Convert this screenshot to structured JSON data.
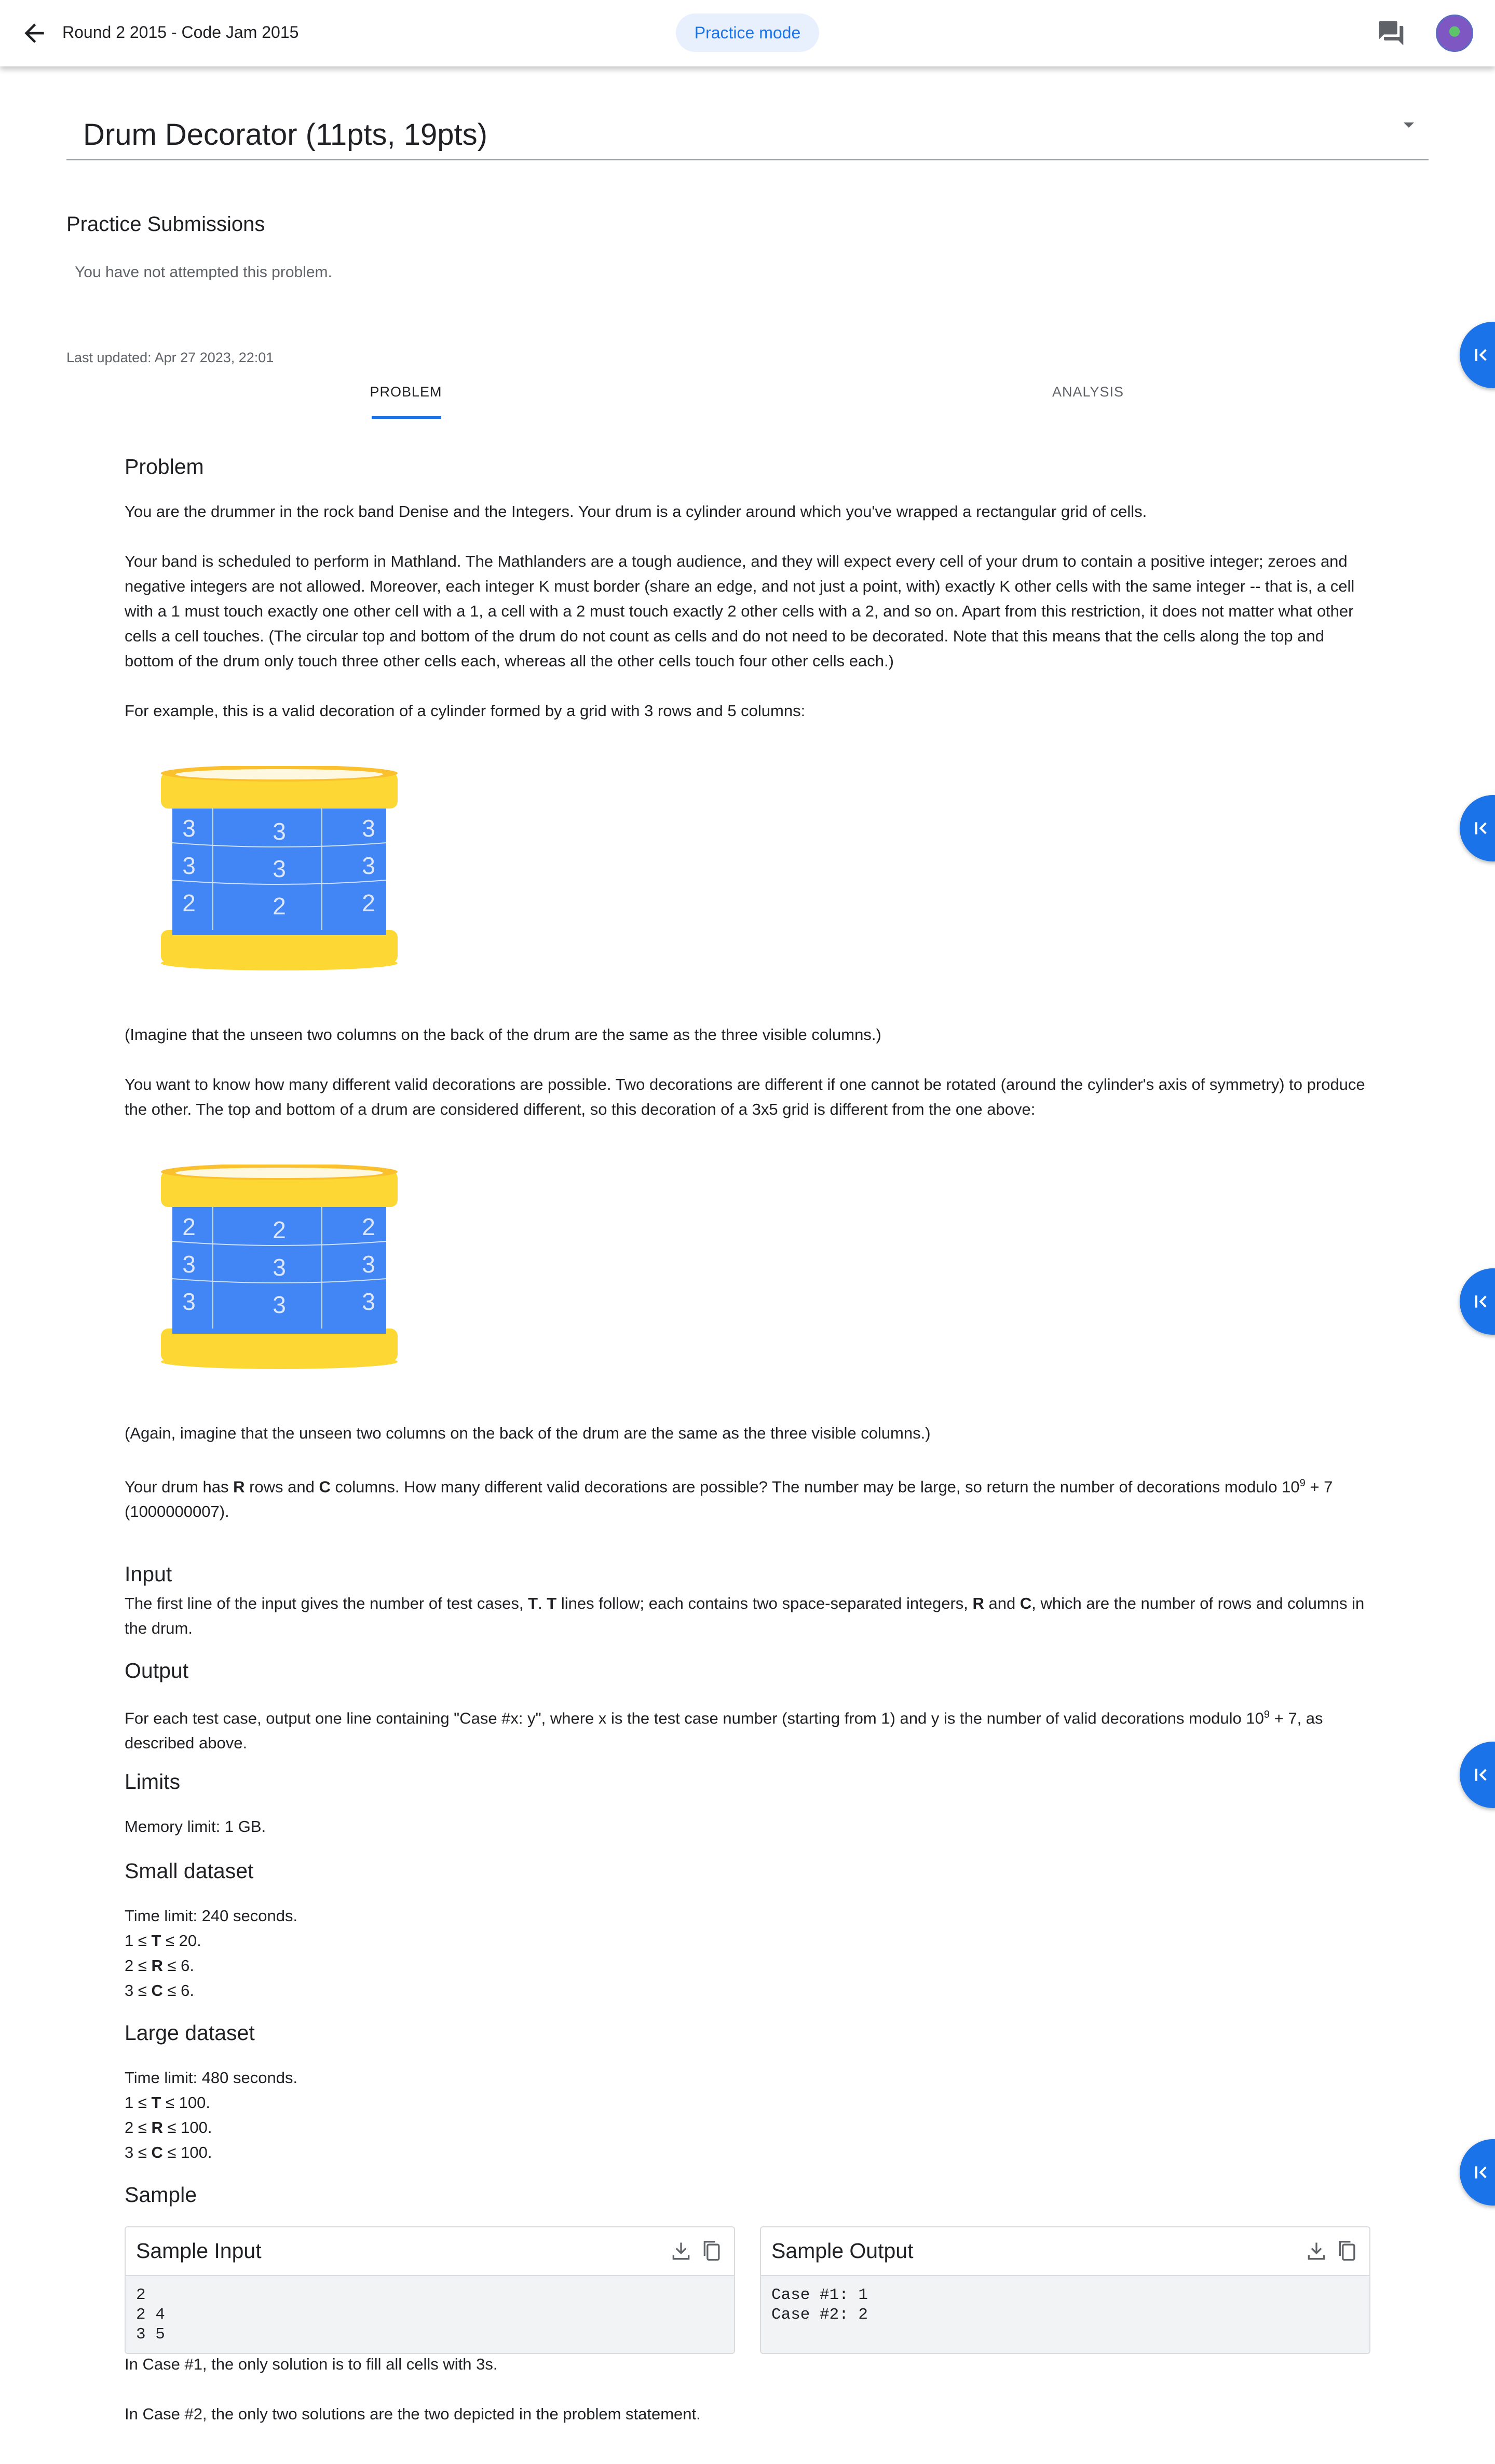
{
  "topbar": {
    "breadcrumb": "Round 2 2015 - Code Jam 2015",
    "mode_chip": "Practice mode"
  },
  "problem_select": {
    "title": "Drum Decorator (11pts, 19pts)"
  },
  "submissions": {
    "heading": "Practice Submissions",
    "empty_note": "You have not attempted this problem."
  },
  "last_updated": "Last updated: Apr 27 2023, 22:01",
  "tabs": [
    {
      "label": "PROBLEM"
    },
    {
      "label": "ANALYSIS"
    }
  ],
  "statement": {
    "h_problem": "Problem",
    "p1": "You are the drummer in the rock band Denise and the Integers. Your drum is a cylinder around which you've wrapped a rectangular grid of cells.",
    "p2": "Your band is scheduled to perform in Mathland. The Mathlanders are a tough audience, and they will expect every cell of your drum to contain a positive integer; zeroes and negative integers are not allowed. Moreover, each integer K must border (share an edge, and not just a point, with) exactly K other cells with the same integer -- that is, a cell with a 1 must touch exactly one other cell with a 1, a cell with a 2 must touch exactly 2 other cells with a 2, and so on. Apart from this restriction, it does not matter what other cells a cell touches. (The circular top and bottom of the drum do not count as cells and do not need to be decorated. Note that this means that the cells along the top and bottom of the drum only touch three other cells each, whereas all the other cells touch four other cells each.)",
    "p3": "For example, this is a valid decoration of a cylinder formed by a grid with 3 rows and 5 columns:",
    "drum1_rows": [
      [
        "3",
        "3",
        "3"
      ],
      [
        "3",
        "3",
        "3"
      ],
      [
        "2",
        "2",
        "2"
      ]
    ],
    "p4": "(Imagine that the unseen two columns on the back of the drum are the same as the three visible columns.)",
    "p5": "You want to know how many different valid decorations are possible. Two decorations are different if one cannot be rotated (around the cylinder's axis of symmetry) to produce the other. The top and bottom of a drum are considered different, so this decoration of a 3x5 grid is different from the one above:",
    "drum2_rows": [
      [
        "2",
        "2",
        "2"
      ],
      [
        "3",
        "3",
        "3"
      ],
      [
        "3",
        "3",
        "3"
      ]
    ],
    "p6": "(Again, imagine that the unseen two columns on the back of the drum are the same as the three visible columns.)",
    "p7_a": "Your drum has ",
    "p7_r": "R",
    "p7_b": " rows and ",
    "p7_c": "C",
    "p7_d": " columns. How many different valid decorations are possible? The number may be large, so return the number of decorations modulo 10",
    "p7_sup": "9",
    "p7_e": " + 7 (1000000007).",
    "h_input": "Input",
    "in_a": "The first line of the input gives the number of test cases, ",
    "in_t1": "T",
    "in_b": ". ",
    "in_t2": "T",
    "in_c": " lines follow; each contains two space-separated integers, ",
    "in_r": "R",
    "in_d": " and ",
    "in_cc": "C",
    "in_e": ", which are the number of rows and columns in the drum.",
    "h_output": "Output",
    "out_a": "For each test case, output one line containing \"Case #x: y\", where x is the test case number (starting from 1) and y is the number of valid decorations modulo 10",
    "out_sup": "9",
    "out_b": " + 7, as described above.",
    "h_limits": "Limits",
    "memory": "Memory limit: 1 GB.",
    "h_small": "Small dataset",
    "small_time": "Time limit: 240 seconds.",
    "small_t": [
      "1 ≤ ",
      "T",
      " ≤ 20."
    ],
    "small_r": [
      "2 ≤ ",
      "R",
      " ≤ 6."
    ],
    "small_c": [
      "3 ≤ ",
      "C",
      " ≤ 6."
    ],
    "h_large": "Large dataset",
    "large_time": "Time limit: 480 seconds.",
    "large_t": [
      "1 ≤ ",
      "T",
      " ≤ 100."
    ],
    "large_r": [
      "2 ≤ ",
      "R",
      " ≤ 100."
    ],
    "large_c": [
      "3 ≤ ",
      "C",
      " ≤ 100."
    ],
    "h_sample": "Sample",
    "sample_input_title": "Sample Input",
    "sample_input_body": "2\n2 4\n3 5",
    "sample_output_title": "Sample Output",
    "sample_output_body": "Case #1: 1\nCase #2: 2",
    "case1": "In Case #1, the only solution is to fill all cells with 3s.",
    "case2": "In Case #2, the only two solutions are the two depicted in the problem statement."
  },
  "colors": {
    "accent": "#1a73e8",
    "chip_bg": "#e8f0fe",
    "drum_body": "#4285f4",
    "drum_rim": "#fdd835"
  },
  "icons": {
    "back": "arrow-back-icon",
    "chat": "chat-icon",
    "side": "collapse-left-icon",
    "download": "download-icon",
    "copy": "copy-icon"
  }
}
